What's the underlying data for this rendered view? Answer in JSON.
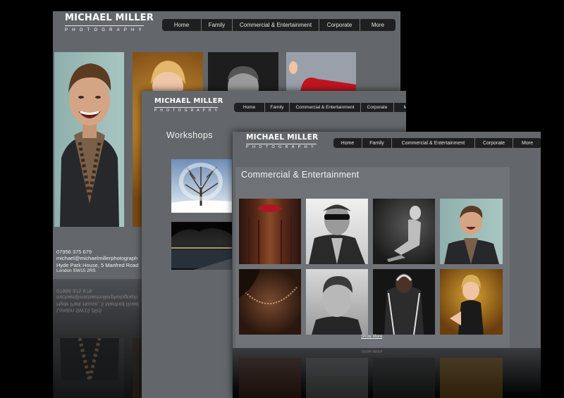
{
  "brand": {
    "name": "MICHAEL MILLER",
    "tagline": "PHOTOGRAPHY"
  },
  "nav": {
    "items": [
      "Home",
      "Family",
      "Commercial & Entertainment",
      "Corporate",
      "More"
    ]
  },
  "page2": {
    "heading": "Workshops"
  },
  "page3": {
    "heading": "Commercial & Entertainment",
    "show_more": "Show More"
  },
  "contact": {
    "phone": "07956 375 679",
    "email": "michael@michaelmillerphotograph",
    "address1": "Hyde Park House, 5 Manfred Road",
    "address2": "London SW15 2RS"
  },
  "colors": {
    "page_bg": "#000000",
    "panel_bg": "#63676b",
    "nav_bg": "#1e1f21",
    "content_panel": "#6f7378"
  }
}
